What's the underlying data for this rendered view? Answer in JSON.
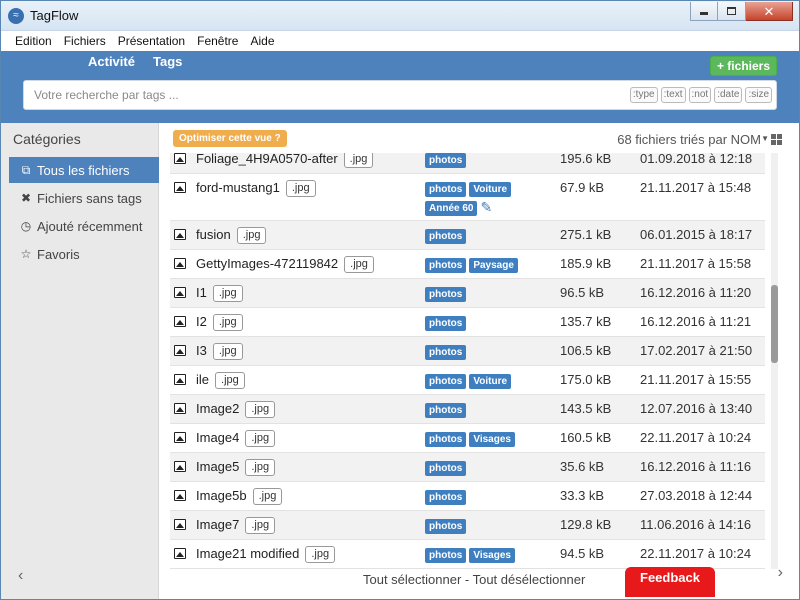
{
  "window": {
    "title": "TagFlow",
    "app_icon": "tagflow-logo-icon"
  },
  "menu": [
    "Edition",
    "Fichiers",
    "Présentation",
    "Fenêtre",
    "Aide"
  ],
  "header": {
    "tabs": [
      "Activité",
      "Tags"
    ],
    "add_files_label": "+ fichiers"
  },
  "search": {
    "placeholder": "Votre recherche par tags ...",
    "value": "",
    "filters": [
      ":type",
      ":text",
      ":not",
      ":date",
      ":size"
    ]
  },
  "sidebar": {
    "title": "Catégories",
    "items": [
      {
        "label": "Tous les fichiers",
        "icon": "files-icon",
        "active": true
      },
      {
        "label": "Fichiers sans tags",
        "icon": "x-icon",
        "active": false
      },
      {
        "label": "Ajouté récemment",
        "icon": "clock-icon",
        "active": false
      },
      {
        "label": "Favoris",
        "icon": "star-icon",
        "active": false
      }
    ]
  },
  "toolbar": {
    "optimize_label": "Optimiser cette vue ?",
    "sort_info": "68 fichiers triés par NOM"
  },
  "files": [
    {
      "name": "Foliage_4H9A0570-after",
      "ext": ".jpg",
      "tags": [
        "photos"
      ],
      "size": "195.6 kB",
      "date": "01.09.2018 à 12:18"
    },
    {
      "name": "ford-mustang1",
      "ext": ".jpg",
      "tags": [
        "photos",
        "Voiture",
        "Année 60"
      ],
      "size": "67.9 kB",
      "date": "21.11.2017 à 15:48",
      "editable": true
    },
    {
      "name": "fusion",
      "ext": ".jpg",
      "tags": [
        "photos"
      ],
      "size": "275.1 kB",
      "date": "06.01.2015 à 18:17"
    },
    {
      "name": "GettyImages-472119842",
      "ext": ".jpg",
      "tags": [
        "photos",
        "Paysage"
      ],
      "size": "185.9 kB",
      "date": "21.11.2017 à 15:58"
    },
    {
      "name": "I1",
      "ext": ".jpg",
      "tags": [
        "photos"
      ],
      "size": "96.5 kB",
      "date": "16.12.2016 à 11:20"
    },
    {
      "name": "I2",
      "ext": ".jpg",
      "tags": [
        "photos"
      ],
      "size": "135.7 kB",
      "date": "16.12.2016 à 11:21"
    },
    {
      "name": "I3",
      "ext": ".jpg",
      "tags": [
        "photos"
      ],
      "size": "106.5 kB",
      "date": "17.02.2017 à 21:50"
    },
    {
      "name": "ile",
      "ext": ".jpg",
      "tags": [
        "photos",
        "Voiture"
      ],
      "size": "175.0 kB",
      "date": "21.11.2017 à 15:55"
    },
    {
      "name": "Image2",
      "ext": ".jpg",
      "tags": [
        "photos"
      ],
      "size": "143.5 kB",
      "date": "12.07.2016 à 13:40"
    },
    {
      "name": "Image4",
      "ext": ".jpg",
      "tags": [
        "photos",
        "Visages"
      ],
      "size": "160.5 kB",
      "date": "22.11.2017 à 10:24"
    },
    {
      "name": "Image5",
      "ext": ".jpg",
      "tags": [
        "photos"
      ],
      "size": "35.6 kB",
      "date": "16.12.2016 à 11:16"
    },
    {
      "name": "Image5b",
      "ext": ".jpg",
      "tags": [
        "photos"
      ],
      "size": "33.3 kB",
      "date": "27.03.2018 à 12:44"
    },
    {
      "name": "Image7",
      "ext": ".jpg",
      "tags": [
        "photos"
      ],
      "size": "129.8 kB",
      "date": "11.06.2016 à 14:16"
    },
    {
      "name": "Image21 modified",
      "ext": ".jpg",
      "tags": [
        "photos",
        "Visages"
      ],
      "size": "94.5 kB",
      "date": "22.11.2017 à 10:24"
    }
  ],
  "footer": {
    "selection_links": "Tout sélectionner - Tout désélectionner",
    "feedback_label": "Feedback"
  }
}
